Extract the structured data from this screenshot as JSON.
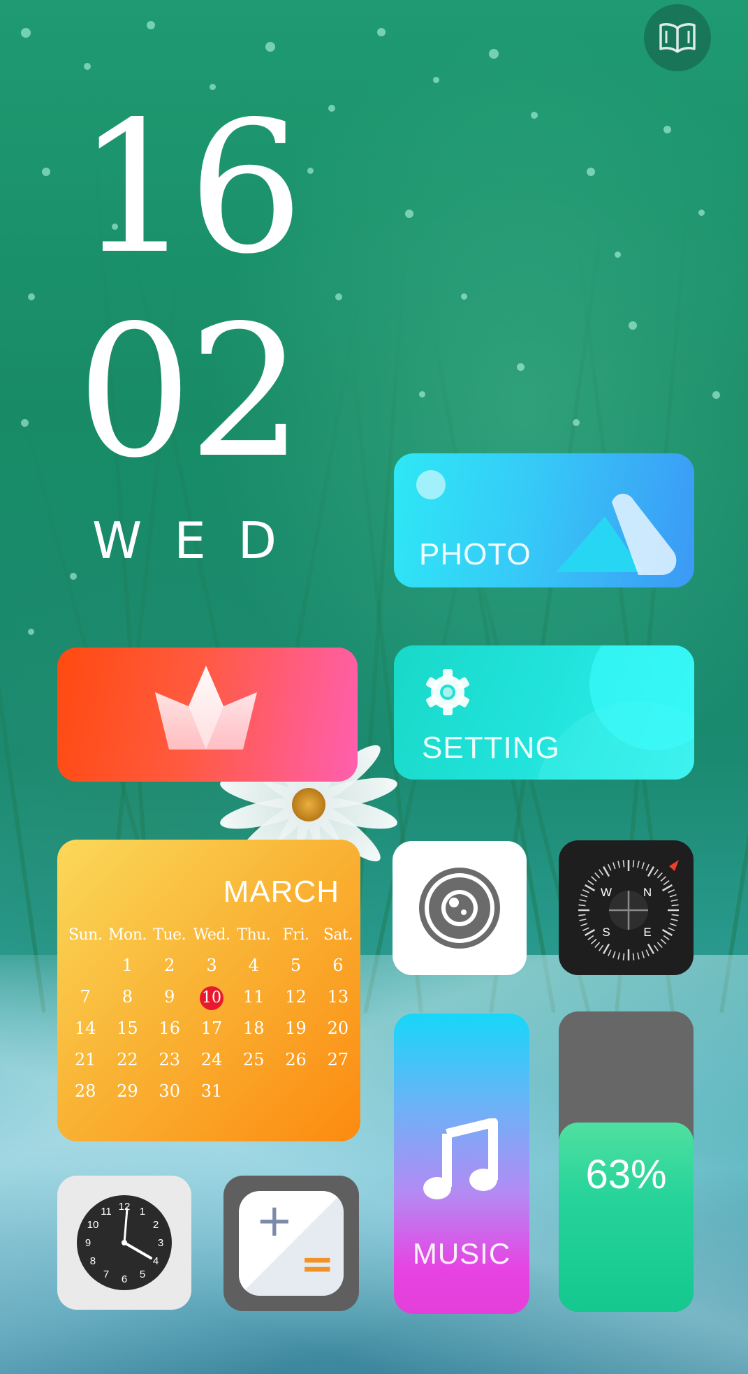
{
  "clock": {
    "hour": "16",
    "minute": "02",
    "weekday": "WED"
  },
  "top_button": {
    "icon": "book-icon"
  },
  "widgets": {
    "photo": {
      "label": "PHOTO",
      "icon": "mountain-icon",
      "gradient": [
        "#2ee8f5",
        "#3c99f5"
      ]
    },
    "crown": {
      "icon": "crown-icon",
      "gradient": [
        "#ff4a10",
        "#ff5fb0"
      ]
    },
    "setting": {
      "label": "SETTING",
      "icon": "gear-icon",
      "gradient": [
        "#18d9c8",
        "#33eff0"
      ]
    },
    "camera": {
      "icon": "camera-lens-icon"
    },
    "compass": {
      "icon": "compass-icon",
      "directions": [
        "W",
        "N",
        "S",
        "E"
      ]
    },
    "music": {
      "label": "MUSIC",
      "icon": "music-note-icon"
    },
    "battery": {
      "percent_label": "63%",
      "level": 0.63,
      "fill_color": "#26d39a"
    },
    "clock_app": {
      "icon": "analog-clock-icon",
      "numbers": [
        "12",
        "1",
        "2",
        "3",
        "4",
        "5",
        "6",
        "7",
        "8",
        "9",
        "10",
        "11"
      ]
    },
    "calculator": {
      "icon": "calculator-icon",
      "plus": "+",
      "equals": "="
    }
  },
  "calendar": {
    "month": "MARCH",
    "weekdays": [
      "Sun.",
      "Mon.",
      "Tue.",
      "Wed.",
      "Thu.",
      "Fri.",
      "Sat."
    ],
    "weeks": [
      [
        "",
        "1",
        "2",
        "3",
        "4",
        "5",
        "6"
      ],
      [
        "7",
        "8",
        "9",
        "10",
        "11",
        "12",
        "13"
      ],
      [
        "14",
        "15",
        "16",
        "17",
        "18",
        "19",
        "20"
      ],
      [
        "21",
        "22",
        "23",
        "24",
        "25",
        "26",
        "27"
      ],
      [
        "28",
        "29",
        "30",
        "31",
        "",
        "",
        ""
      ]
    ],
    "today": "10",
    "today_color": "#e8192c"
  }
}
